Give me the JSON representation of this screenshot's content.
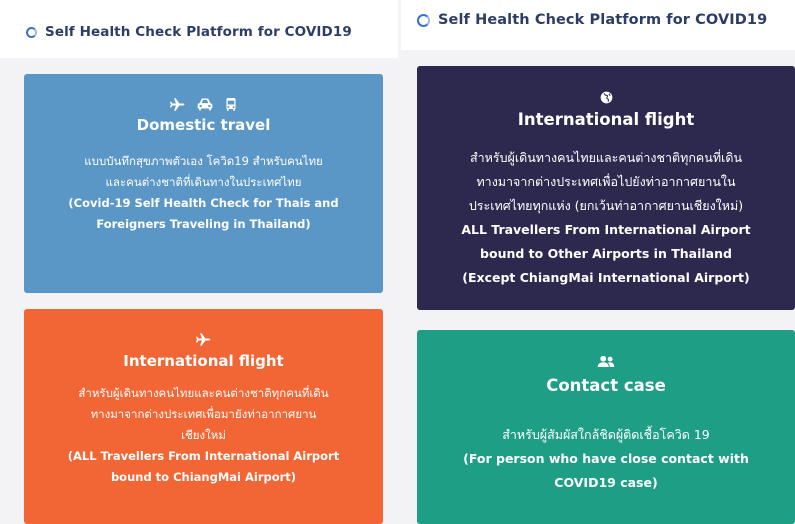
{
  "left_panel": {
    "header": "Self Health Check Platform for COVID19",
    "cards": [
      {
        "title": "Domestic travel",
        "icons": [
          "airplane-icon",
          "car-icon",
          "bus-icon"
        ],
        "desc_th_1": "แบบบันทึกสุขภาพตัวเอง โควิด19 สำหรับคนไทย",
        "desc_th_2": "และคนต่างชาติที่เดินทางในประเทศไทย",
        "desc_en_1": "(Covid-19 Self Health Check for Thais and",
        "desc_en_2": "Foreigners Traveling in Thailand)",
        "color": "#5b97c6"
      },
      {
        "title": "International flight",
        "icons": [
          "airplane-icon"
        ],
        "desc_th_1": "สำหรับผู้เดินทางคนไทยและคนต่างชาติทุกคนที่เดิน",
        "desc_th_2": "ทางมาจากต่างประเทศเพื่อมายังท่าอากาศยาน",
        "desc_th_3": "เชียงใหม่",
        "desc_en_1": "(ALL Travellers From International Airport",
        "desc_en_2": "bound to ChiangMai Airport)",
        "color": "#f26535"
      }
    ]
  },
  "right_panel": {
    "header": "Self Health Check Platform for COVID19",
    "cards": [
      {
        "title": "International flight",
        "icons": [
          "globe-icon"
        ],
        "desc_th_1": "สำหรับผู้เดินทางคนไทยและคนต่างชาติทุกคนที่เดิน",
        "desc_th_2": "ทางมาจากต่างประเทศเพื่อไปยังท่าอากาศยานใน",
        "desc_th_3": "ประเทศไทยทุกแห่ง (ยกเว้นท่าอากาศยานเชียงใหม่)",
        "desc_en_1": "ALL Travellers From International Airport",
        "desc_en_2": "bound to Other Airports in Thailand",
        "desc_en_3": "(Except ChiangMai International Airport)",
        "color": "#2d284e"
      },
      {
        "title": "Contact case",
        "icons": [
          "users-icon"
        ],
        "desc_th_1": "สำหรับผู้สัมผัสใกล้ชิดผู้ติดเชื้อโควิด 19",
        "desc_en_1": "(For person who have close contact with",
        "desc_en_2": "COVID19 case)",
        "color": "#1d9e85"
      }
    ]
  }
}
